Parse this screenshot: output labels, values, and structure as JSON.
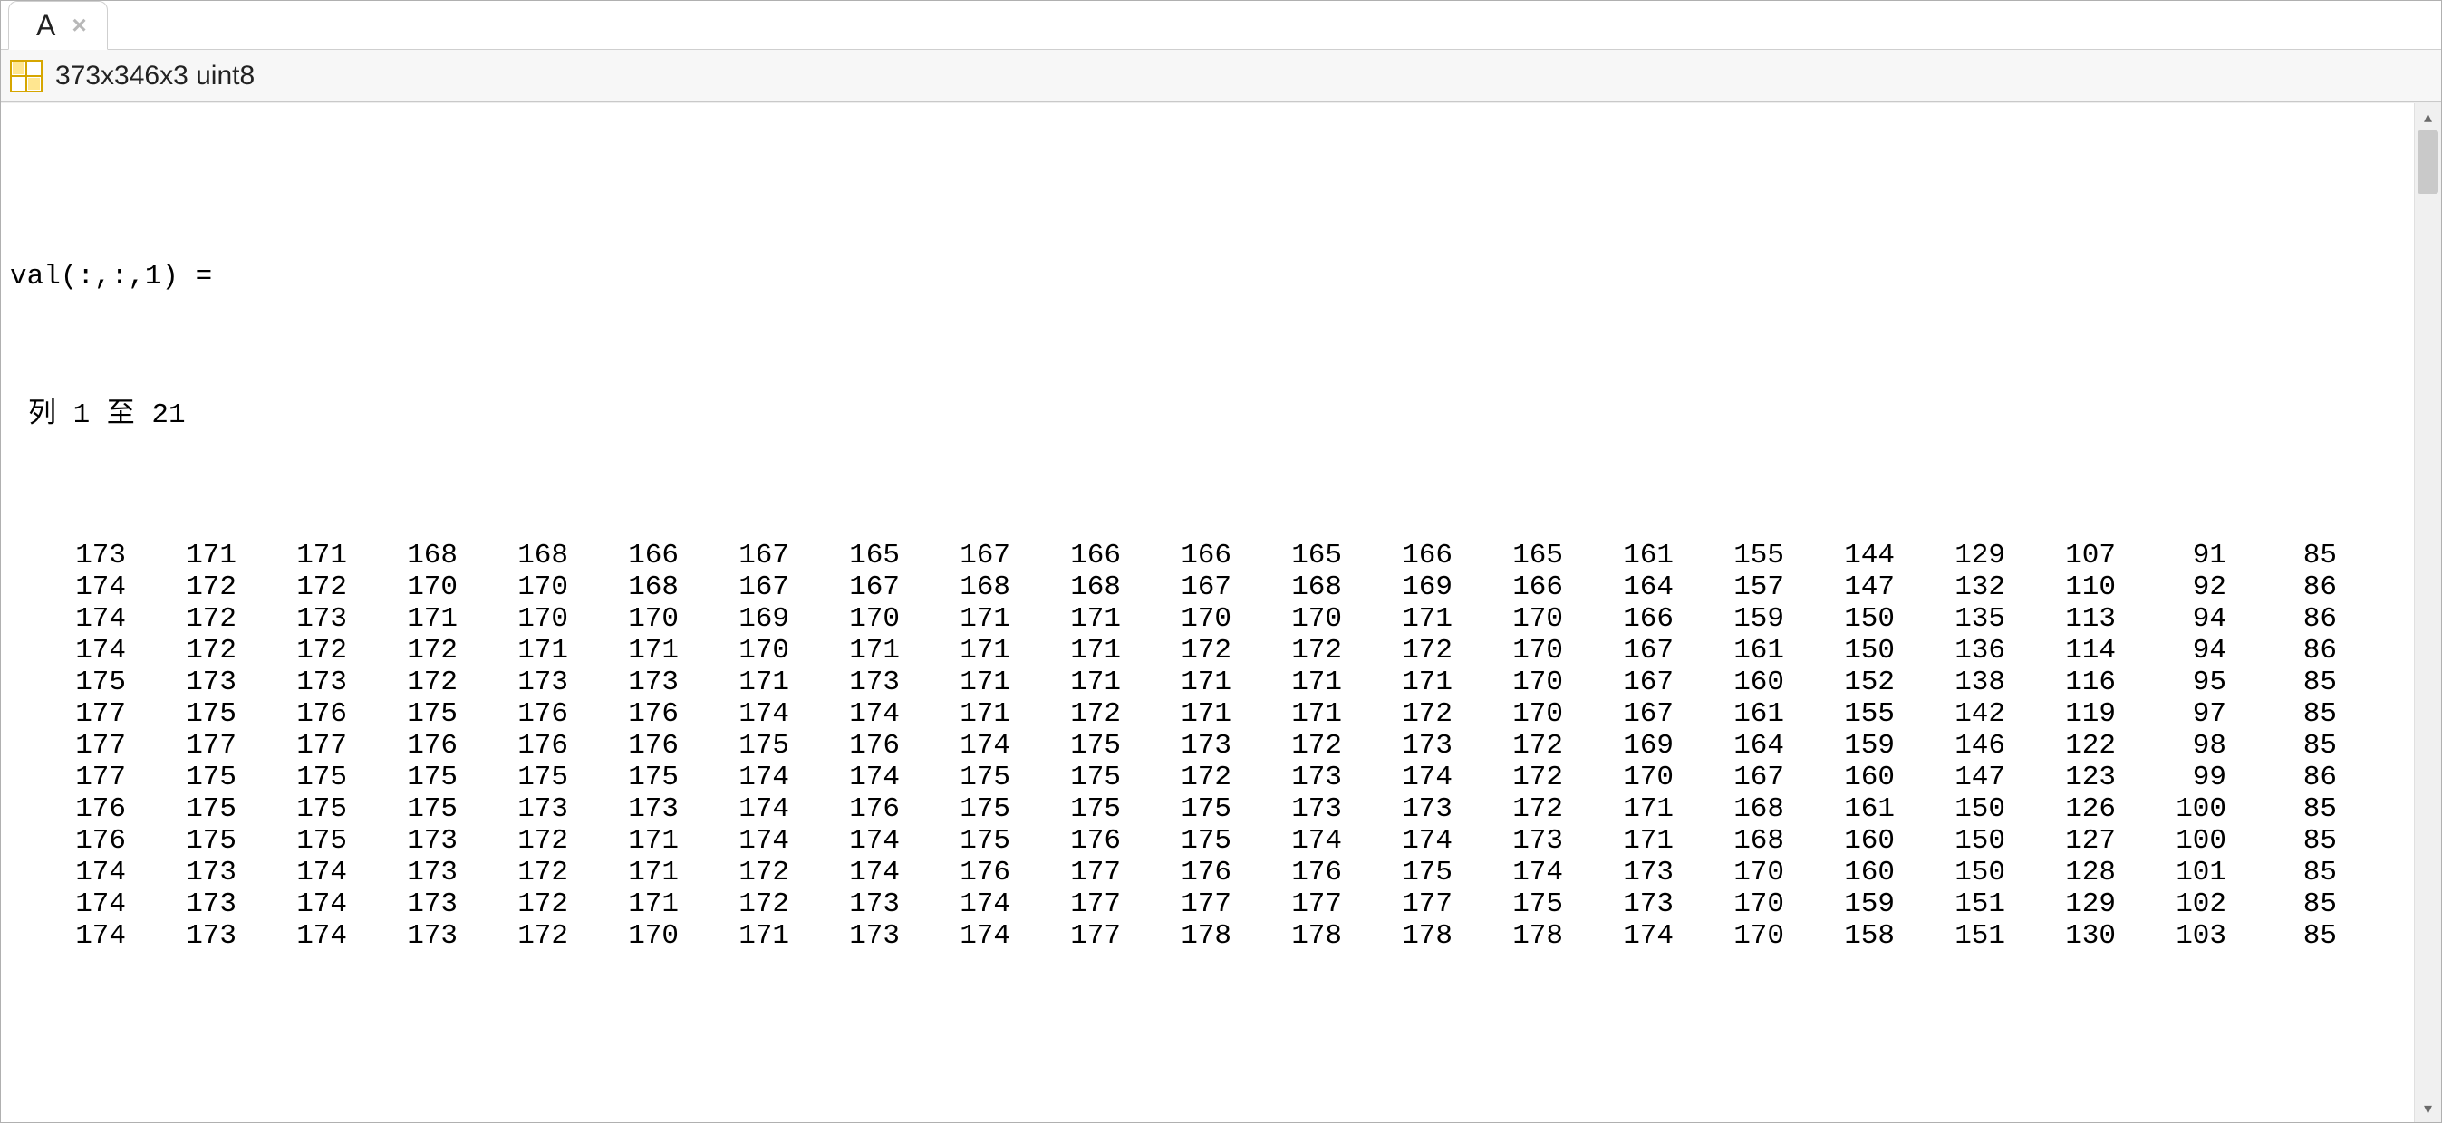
{
  "tab": {
    "label": "A",
    "close_glyph": "×"
  },
  "meta": {
    "dims_text": "373x346x3 uint8"
  },
  "content": {
    "val_header": "val(:,:,1) =",
    "col_header": "列 1 至 21",
    "matrix": [
      [
        173,
        171,
        171,
        168,
        168,
        166,
        167,
        165,
        167,
        166,
        166,
        165,
        166,
        165,
        161,
        155,
        144,
        129,
        107,
        91,
        85
      ],
      [
        174,
        172,
        172,
        170,
        170,
        168,
        167,
        167,
        168,
        168,
        167,
        168,
        169,
        166,
        164,
        157,
        147,
        132,
        110,
        92,
        86
      ],
      [
        174,
        172,
        173,
        171,
        170,
        170,
        169,
        170,
        171,
        171,
        170,
        170,
        171,
        170,
        166,
        159,
        150,
        135,
        113,
        94,
        86
      ],
      [
        174,
        172,
        172,
        172,
        171,
        171,
        170,
        171,
        171,
        171,
        172,
        172,
        172,
        170,
        167,
        161,
        150,
        136,
        114,
        94,
        86
      ],
      [
        175,
        173,
        173,
        172,
        173,
        173,
        171,
        173,
        171,
        171,
        171,
        171,
        171,
        170,
        167,
        160,
        152,
        138,
        116,
        95,
        85
      ],
      [
        177,
        175,
        176,
        175,
        176,
        176,
        174,
        174,
        171,
        172,
        171,
        171,
        172,
        170,
        167,
        161,
        155,
        142,
        119,
        97,
        85
      ],
      [
        177,
        177,
        177,
        176,
        176,
        176,
        175,
        176,
        174,
        175,
        173,
        172,
        173,
        172,
        169,
        164,
        159,
        146,
        122,
        98,
        85
      ],
      [
        177,
        175,
        175,
        175,
        175,
        175,
        174,
        174,
        175,
        175,
        172,
        173,
        174,
        172,
        170,
        167,
        160,
        147,
        123,
        99,
        86
      ],
      [
        176,
        175,
        175,
        175,
        173,
        173,
        174,
        176,
        175,
        175,
        175,
        173,
        173,
        172,
        171,
        168,
        161,
        150,
        126,
        100,
        85
      ],
      [
        176,
        175,
        175,
        173,
        172,
        171,
        174,
        174,
        175,
        176,
        175,
        174,
        174,
        173,
        171,
        168,
        160,
        150,
        127,
        100,
        85
      ],
      [
        174,
        173,
        174,
        173,
        172,
        171,
        172,
        174,
        176,
        177,
        176,
        176,
        175,
        174,
        173,
        170,
        160,
        150,
        128,
        101,
        85
      ],
      [
        174,
        173,
        174,
        173,
        172,
        171,
        172,
        173,
        174,
        177,
        177,
        177,
        177,
        175,
        173,
        170,
        159,
        151,
        129,
        102,
        85
      ],
      [
        174,
        173,
        174,
        173,
        172,
        170,
        171,
        173,
        174,
        177,
        178,
        178,
        178,
        178,
        174,
        170,
        158,
        151,
        130,
        103,
        85
      ]
    ]
  },
  "scrollbar": {
    "up_glyph": "▴",
    "down_glyph": "▾"
  }
}
